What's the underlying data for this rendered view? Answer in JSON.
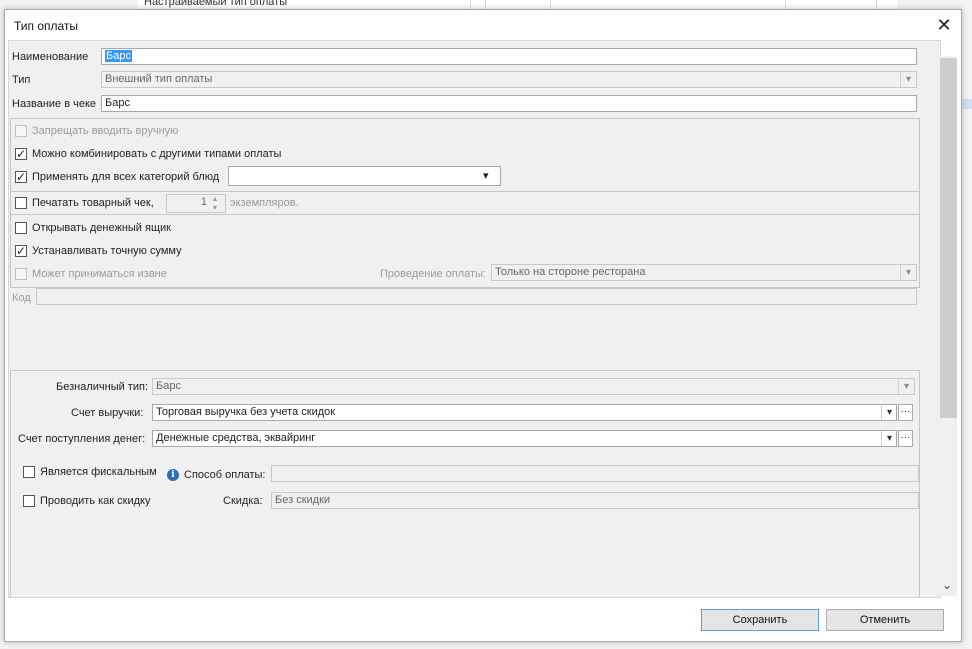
{
  "background": {
    "row_text": "Настраиваемый тип оплаты"
  },
  "dialog": {
    "title": "Тип оплаты",
    "close_glyph": "✕"
  },
  "form": {
    "name": {
      "label": "Наименование",
      "value": "Барс"
    },
    "type": {
      "label": "Тип",
      "value": "Внешний тип оплаты"
    },
    "receipt_name": {
      "label": "Название в чеке",
      "value": "Барс"
    },
    "forbid_manual": {
      "label": "Запрещать вводить вручную",
      "checked": false,
      "disabled": true
    },
    "combine": {
      "label": "Можно комбинировать с другими типами оплаты",
      "checked": true
    },
    "apply_all": {
      "label": "Применять для всех категорий блюд",
      "checked": true,
      "value": ""
    },
    "print_check": {
      "label": "Печатать товарный чек,",
      "count": "1",
      "suffix": "экземпляров."
    },
    "open_drawer": {
      "label": "Открывать денежный ящик",
      "checked": false
    },
    "exact_sum": {
      "label": "Устанавливать точную сумму",
      "checked": true
    },
    "external": {
      "label": "Может приниматься извне",
      "checked": false,
      "disabled": true
    },
    "posting": {
      "label": "Проведение оплаты:",
      "value": "Только на стороне ресторана"
    },
    "code": {
      "label": "Код",
      "value": ""
    }
  },
  "cashless": {
    "type": {
      "label": "Безналичный тип:",
      "value": "Барс"
    },
    "revenue_account": {
      "label": "Счет выручки:",
      "value": "Торговая выручка без учета скидок"
    },
    "money_account": {
      "label": "Счет поступления денег:",
      "value": "Денежные средства, эквайринг"
    },
    "fiscal": {
      "label": "Является фискальным",
      "checked": false
    },
    "payment_method": {
      "label": "Способ оплаты:",
      "value": ""
    },
    "as_discount": {
      "label": "Проводить как скидку",
      "checked": false
    },
    "discount": {
      "label": "Скидка:",
      "value": "Без скидки"
    }
  },
  "footer": {
    "save": "Сохранить",
    "cancel": "Отменить"
  },
  "glyphs": {
    "check": "✓",
    "dropdown": "▾",
    "ellipsis": "···",
    "scroll_down": "⌄",
    "info": "i",
    "spin_up": "▴",
    "spin_down": "▾"
  }
}
